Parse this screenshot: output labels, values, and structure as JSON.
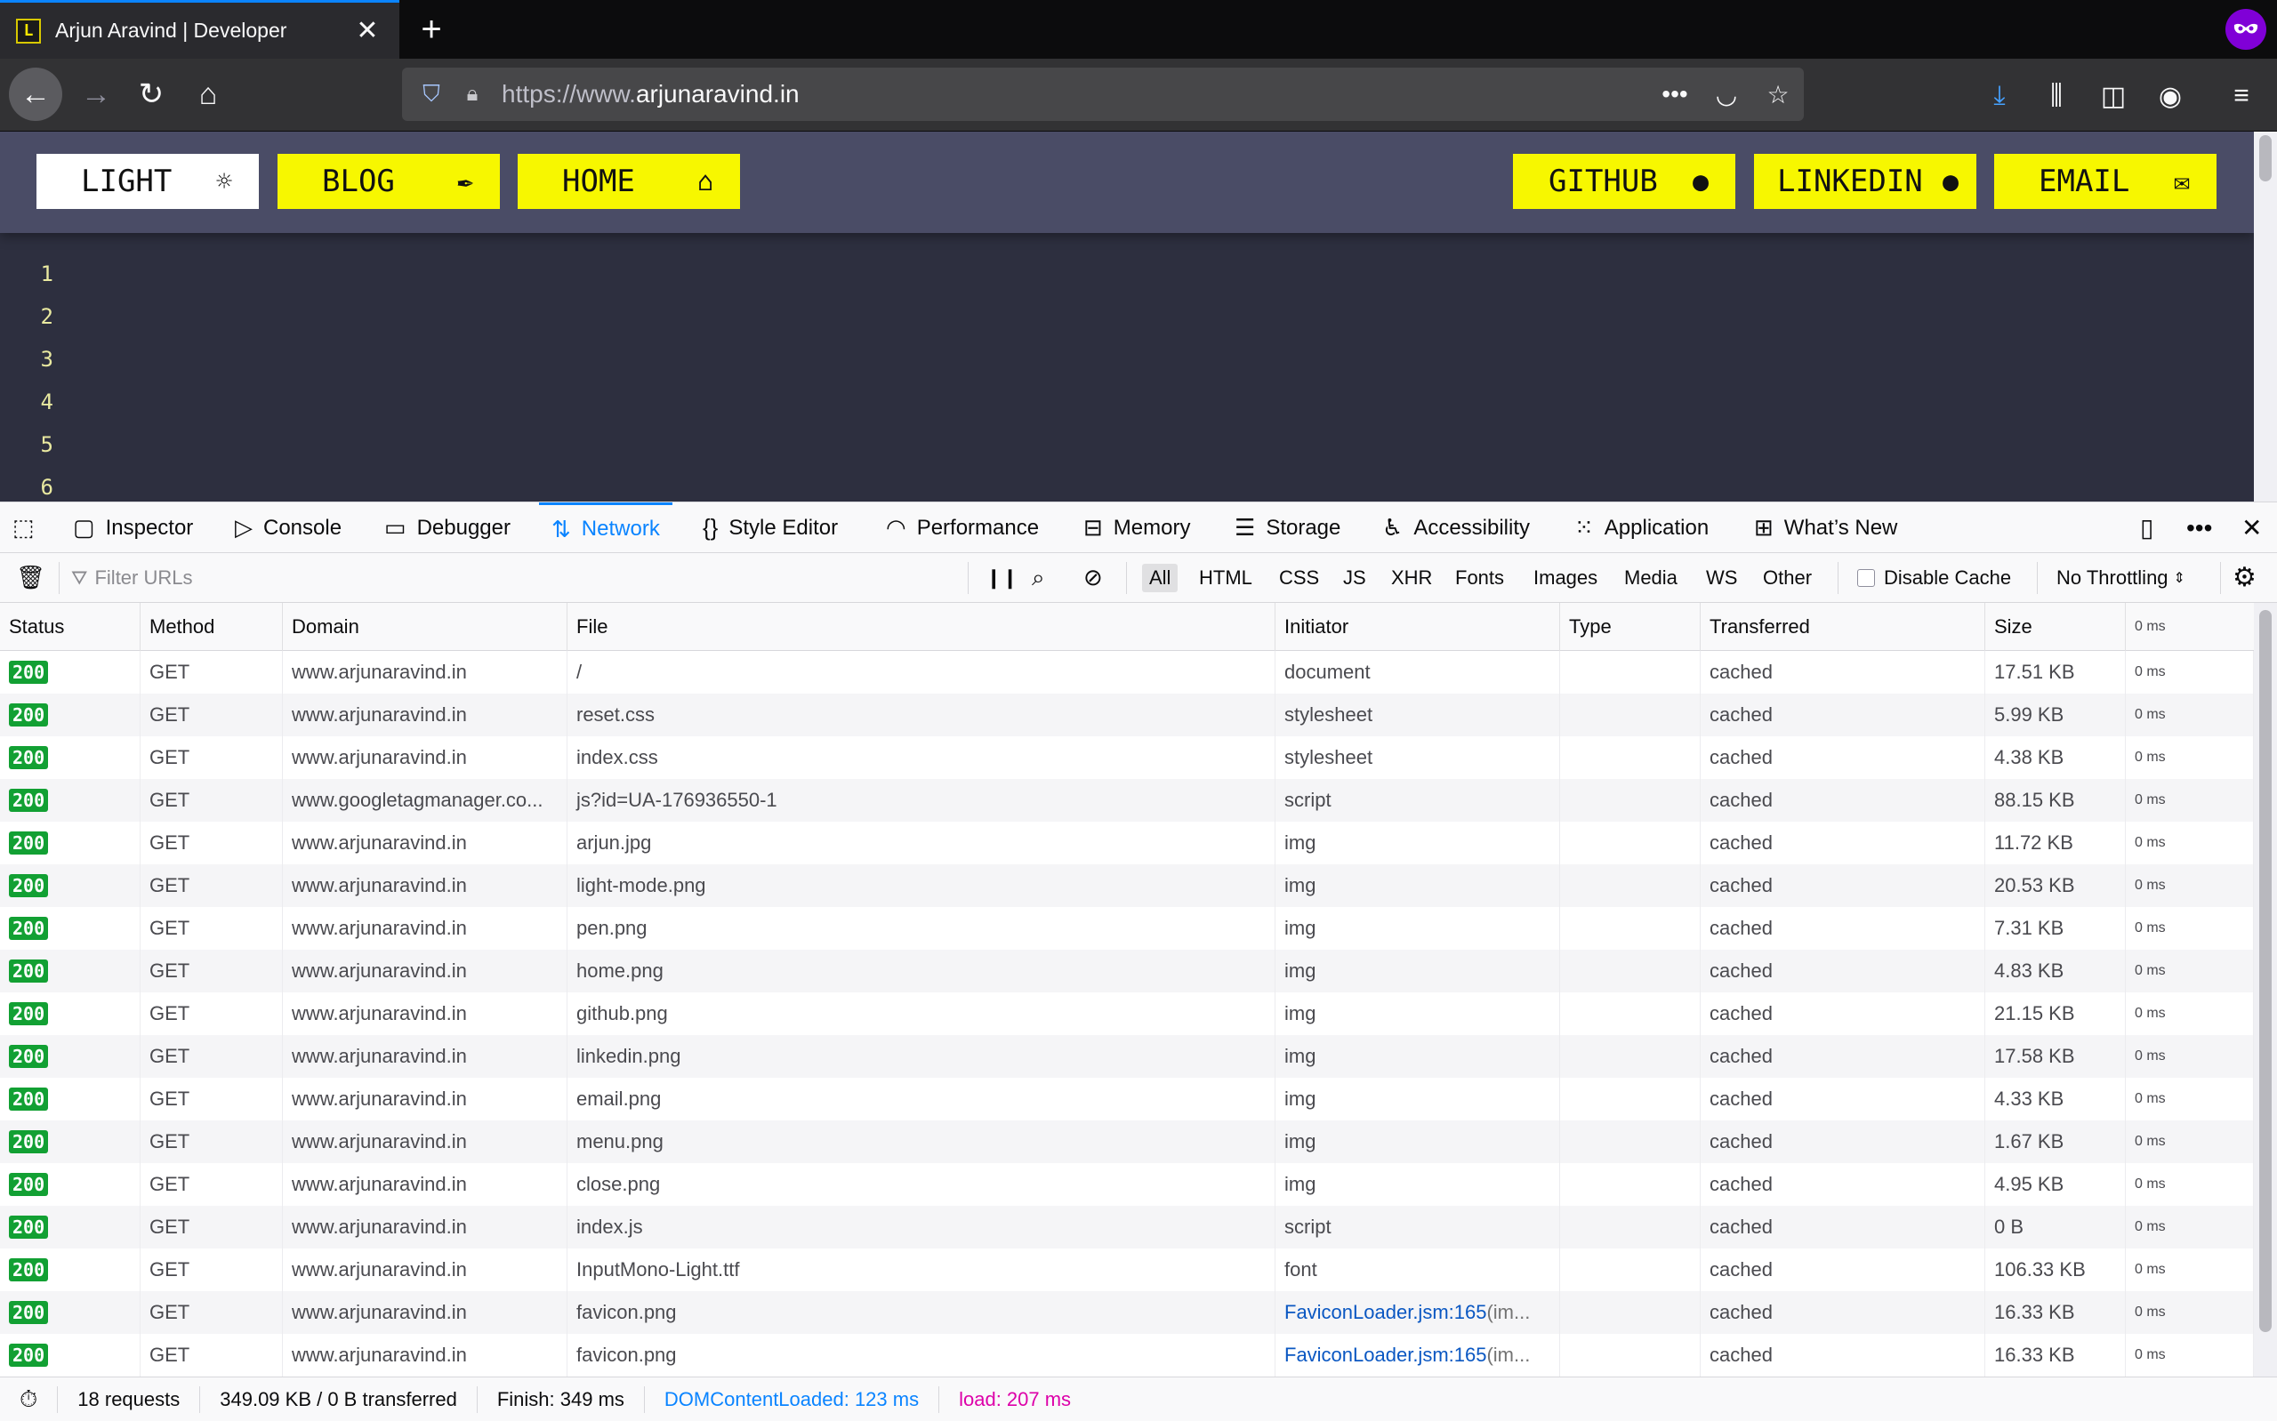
{
  "browser": {
    "tab_title": "Arjun Aravind | Developer",
    "favicon_letter": "L",
    "url_scheme": "https://www.",
    "url_host": "arjunaravind.in"
  },
  "page": {
    "buttons": [
      {
        "label": "LIGHT",
        "icon": "sun-icon"
      },
      {
        "label": "BLOG",
        "icon": "pen-icon"
      },
      {
        "label": "HOME",
        "icon": "home-icon"
      },
      {
        "label": "GITHUB",
        "icon": "github-icon"
      },
      {
        "label": "LINKEDIN",
        "icon": "linkedin-icon"
      },
      {
        "label": "EMAIL",
        "icon": "email-icon"
      }
    ],
    "line_numbers": [
      "1",
      "2",
      "3",
      "4",
      "5",
      "6"
    ],
    "colors": {
      "accent": "#f7f700",
      "bg": "#2d2f3f",
      "nav": "#4a4c66"
    }
  },
  "devtools": {
    "tabs": [
      "Inspector",
      "Console",
      "Debugger",
      "Network",
      "Style Editor",
      "Performance",
      "Memory",
      "Storage",
      "Accessibility",
      "Application",
      "What’s New"
    ],
    "active_tab": "Network",
    "filter_placeholder": "Filter URLs",
    "type_filters": [
      "All",
      "HTML",
      "CSS",
      "JS",
      "XHR",
      "Fonts",
      "Images",
      "Media",
      "WS",
      "Other"
    ],
    "disable_cache_label": "Disable Cache",
    "throttling": "No Throttling"
  },
  "table": {
    "columns": [
      "Status",
      "Method",
      "Domain",
      "File",
      "Initiator",
      "Type",
      "Transferred",
      "Size",
      "0 ms"
    ],
    "rows": [
      {
        "status": "200",
        "method": "GET",
        "domain": "www.arjunaravind.in",
        "file": "/",
        "initiator": "document",
        "initiator_extra": "",
        "type": "",
        "transferred": "cached",
        "size": "17.51 KB",
        "time": "0 ms"
      },
      {
        "status": "200",
        "method": "GET",
        "domain": "www.arjunaravind.in",
        "file": "reset.css",
        "initiator": "stylesheet",
        "initiator_extra": "",
        "type": "",
        "transferred": "cached",
        "size": "5.99 KB",
        "time": "0 ms"
      },
      {
        "status": "200",
        "method": "GET",
        "domain": "www.arjunaravind.in",
        "file": "index.css",
        "initiator": "stylesheet",
        "initiator_extra": "",
        "type": "",
        "transferred": "cached",
        "size": "4.38 KB",
        "time": "0 ms"
      },
      {
        "status": "200",
        "method": "GET",
        "domain": "www.googletagmanager.co...",
        "file": "js?id=UA-176936550-1",
        "initiator": "script",
        "initiator_extra": "",
        "type": "",
        "transferred": "cached",
        "size": "88.15 KB",
        "time": "0 ms"
      },
      {
        "status": "200",
        "method": "GET",
        "domain": "www.arjunaravind.in",
        "file": "arjun.jpg",
        "initiator": "img",
        "initiator_extra": "",
        "type": "",
        "transferred": "cached",
        "size": "11.72 KB",
        "time": "0 ms"
      },
      {
        "status": "200",
        "method": "GET",
        "domain": "www.arjunaravind.in",
        "file": "light-mode.png",
        "initiator": "img",
        "initiator_extra": "",
        "type": "",
        "transferred": "cached",
        "size": "20.53 KB",
        "time": "0 ms"
      },
      {
        "status": "200",
        "method": "GET",
        "domain": "www.arjunaravind.in",
        "file": "pen.png",
        "initiator": "img",
        "initiator_extra": "",
        "type": "",
        "transferred": "cached",
        "size": "7.31 KB",
        "time": "0 ms"
      },
      {
        "status": "200",
        "method": "GET",
        "domain": "www.arjunaravind.in",
        "file": "home.png",
        "initiator": "img",
        "initiator_extra": "",
        "type": "",
        "transferred": "cached",
        "size": "4.83 KB",
        "time": "0 ms"
      },
      {
        "status": "200",
        "method": "GET",
        "domain": "www.arjunaravind.in",
        "file": "github.png",
        "initiator": "img",
        "initiator_extra": "",
        "type": "",
        "transferred": "cached",
        "size": "21.15 KB",
        "time": "0 ms"
      },
      {
        "status": "200",
        "method": "GET",
        "domain": "www.arjunaravind.in",
        "file": "linkedin.png",
        "initiator": "img",
        "initiator_extra": "",
        "type": "",
        "transferred": "cached",
        "size": "17.58 KB",
        "time": "0 ms"
      },
      {
        "status": "200",
        "method": "GET",
        "domain": "www.arjunaravind.in",
        "file": "email.png",
        "initiator": "img",
        "initiator_extra": "",
        "type": "",
        "transferred": "cached",
        "size": "4.33 KB",
        "time": "0 ms"
      },
      {
        "status": "200",
        "method": "GET",
        "domain": "www.arjunaravind.in",
        "file": "menu.png",
        "initiator": "img",
        "initiator_extra": "",
        "type": "",
        "transferred": "cached",
        "size": "1.67 KB",
        "time": "0 ms"
      },
      {
        "status": "200",
        "method": "GET",
        "domain": "www.arjunaravind.in",
        "file": "close.png",
        "initiator": "img",
        "initiator_extra": "",
        "type": "",
        "transferred": "cached",
        "size": "4.95 KB",
        "time": "0 ms"
      },
      {
        "status": "200",
        "method": "GET",
        "domain": "www.arjunaravind.in",
        "file": "index.js",
        "initiator": "script",
        "initiator_extra": "",
        "type": "",
        "transferred": "cached",
        "size": "0 B",
        "time": "0 ms"
      },
      {
        "status": "200",
        "method": "GET",
        "domain": "www.arjunaravind.in",
        "file": "InputMono-Light.ttf",
        "initiator": "font",
        "initiator_extra": "",
        "type": "",
        "transferred": "cached",
        "size": "106.33 KB",
        "time": "0 ms"
      },
      {
        "status": "200",
        "method": "GET",
        "domain": "www.arjunaravind.in",
        "file": "favicon.png",
        "initiator": "FaviconLoader.jsm:165",
        "initiator_extra": " (im...",
        "type": "",
        "transferred": "cached",
        "size": "16.33 KB",
        "time": "0 ms"
      },
      {
        "status": "200",
        "method": "GET",
        "domain": "www.arjunaravind.in",
        "file": "favicon.png",
        "initiator": "FaviconLoader.jsm:165",
        "initiator_extra": " (im...",
        "type": "",
        "transferred": "cached",
        "size": "16.33 KB",
        "time": "0 ms"
      }
    ]
  },
  "footer": {
    "requests": "18 requests",
    "transferred": "349.09 KB / 0 B transferred",
    "finish": "Finish: 349 ms",
    "dom_loaded": "DOMContentLoaded: 123 ms",
    "load": "load: 207 ms"
  }
}
